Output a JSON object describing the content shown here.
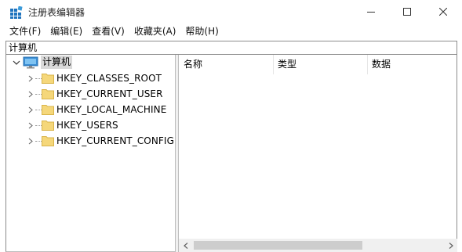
{
  "window": {
    "title": "注册表编辑器",
    "minimize_icon": "minimize-icon",
    "maximize_icon": "maximize-icon",
    "close_icon": "close-icon"
  },
  "menu": {
    "items": [
      {
        "label": "文件(F)"
      },
      {
        "label": "编辑(E)"
      },
      {
        "label": "查看(V)"
      },
      {
        "label": "收藏夹(A)"
      },
      {
        "label": "帮助(H)"
      }
    ]
  },
  "address": {
    "value": "计算机"
  },
  "tree": {
    "root": {
      "label": "计算机",
      "icon": "computer-icon"
    },
    "items": [
      {
        "label": "HKEY_CLASSES_ROOT"
      },
      {
        "label": "HKEY_CURRENT_USER"
      },
      {
        "label": "HKEY_LOCAL_MACHINE"
      },
      {
        "label": "HKEY_USERS"
      },
      {
        "label": "HKEY_CURRENT_CONFIG"
      }
    ]
  },
  "list": {
    "columns": [
      {
        "label": "名称"
      },
      {
        "label": "类型"
      },
      {
        "label": "数据"
      }
    ]
  },
  "colors": {
    "folder": "#f5d77a",
    "border": "#8c8c8c",
    "scroll_thumb": "#cdcdcd",
    "selection": "#d9d9d9"
  }
}
